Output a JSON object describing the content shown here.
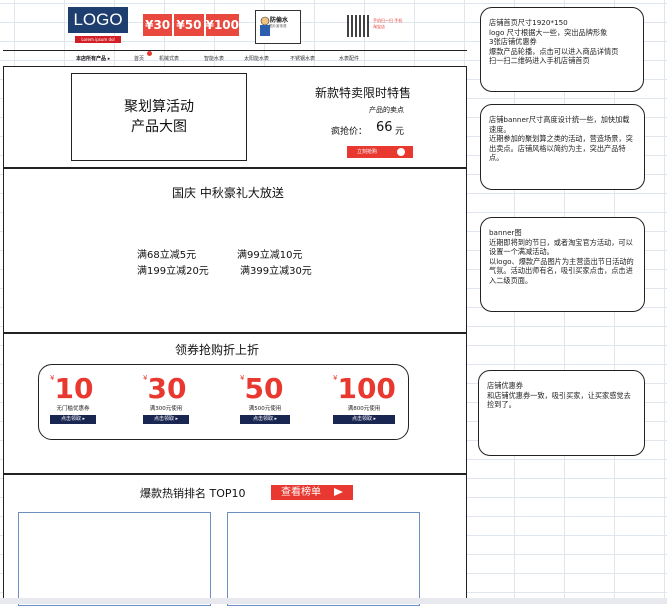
{
  "header": {
    "logo": "LOGO",
    "logo_sub": "Lorem ipsum dol",
    "coupon_strip": [
      "¥30",
      "¥50",
      "¥100"
    ],
    "mascot_name": "防偷水",
    "mascot_sub": "图片宣传语",
    "qr_text": "手机扫一扫 手机淘宝店"
  },
  "nav": {
    "items": [
      "本店所有产品 ▸",
      "首页",
      "机械式表",
      "智能水表",
      "太阳能水表",
      "不锈钢水表",
      "水表配件"
    ]
  },
  "section1": {
    "banner_lines": [
      "聚划算活动",
      "产品大图"
    ],
    "title": "新款特卖限时特售",
    "subtitle": "产品的卖点",
    "price_label": "疯抢价：",
    "price": "66",
    "price_unit": "元",
    "buy_label": "立刻抢购"
  },
  "section2": {
    "title": "国庆 中秋豪礼大放送",
    "discounts": [
      "满68立减5元",
      "满99立减10元",
      "满199立减20元",
      "满399立减30元"
    ]
  },
  "section3": {
    "title": "领券抢购折上折",
    "coupons": [
      {
        "yen": "¥",
        "value": "10",
        "desc": "无门槛优惠券",
        "btn": "点击领取 ▸"
      },
      {
        "yen": "¥",
        "value": "30",
        "desc": "满300元使用",
        "btn": "点击领取 ▸"
      },
      {
        "yen": "¥",
        "value": "50",
        "desc": "满500元使用",
        "btn": "点击领取 ▸"
      },
      {
        "yen": "¥",
        "value": "100",
        "desc": "满800元使用",
        "btn": "点击领取 ▸"
      }
    ]
  },
  "section4": {
    "title": "爆款热销排名 TOP10",
    "btn": "查看榜单"
  },
  "notes": [
    "店铺首页尺寸1920*150\nlogo 尺寸根据大一些，突出品牌形象\n3张店铺优惠券\n爆款产品轮播，点击可以进入商品详情页\n扫一扫二维码进入手机店铺首页",
    "店铺banner尺寸高度设计统一些，加快加载速度。\n近期参加的聚划算之类的活动，营造场景，突出卖点。店铺风格以简约为主，突出产品特点。",
    "banner图\n近期即将到的节日，或者淘宝官方活动，可以设置一个满减活动。\n以logo、爆款产品图片为主营造出节日活动的气氛。活动出师有名，吸引买家点击，点击进入二级页面。",
    "店铺优惠券\n和店铺优惠券一致，吸引买家，让买家感觉去捡到了。"
  ],
  "colors": {
    "accent": "#e8382f",
    "navy": "#1a2652",
    "logo_bg": "#1d3e6f"
  }
}
